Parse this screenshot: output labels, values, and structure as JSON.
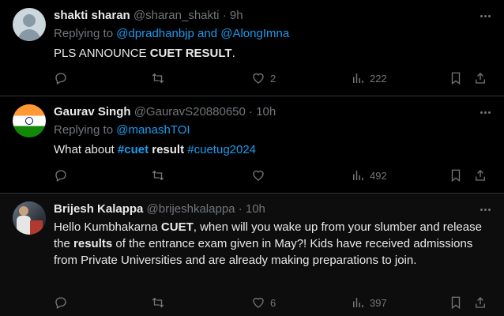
{
  "tweets": [
    {
      "name": "shakti sharan",
      "handle": "@sharan_shakti",
      "sep": "·",
      "time": "9h",
      "replying_prefix": "Replying to ",
      "mention1": "@dpradhanbjp",
      "mention_joiner": " and ",
      "mention2": "@AlongImna",
      "text_plain": "PLS ANNOUNCE ",
      "text_bold": "CUET RESULT",
      "text_end": ".",
      "likes": "2",
      "views": "222"
    },
    {
      "name": "Gaurav Singh",
      "handle": "@GauravS20880650",
      "sep": "·",
      "time": "10h",
      "replying_prefix": "Replying to ",
      "mention1": "@manashTOI",
      "text_plain": "What about ",
      "tag1": "#cuet",
      "text_bold": "result",
      "tag2": "#cuetug2024",
      "views": "492"
    },
    {
      "name": "Brijesh Kalappa",
      "handle": "@brijeshkalappa",
      "sep": "·",
      "time": "10h",
      "text_a": "Hello Kumbhakarna ",
      "text_b": "CUET",
      "text_c": ", when will you wake up from your slumber and release the ",
      "text_d": "results",
      "text_e": " of the entrance exam given in May?! Kids have received admissions from Private Universities and are already making preparations to join.",
      "likes": "6",
      "views": "397"
    }
  ],
  "colors": {
    "background": "#000000",
    "text": "#e7e9ea",
    "muted": "#71767b",
    "link": "#1d9bf0",
    "divider": "#2f3336"
  },
  "icons": [
    "more-icon",
    "reply-icon",
    "retweet-icon",
    "like-icon",
    "views-icon",
    "bookmark-icon",
    "share-icon",
    "avatar"
  ]
}
